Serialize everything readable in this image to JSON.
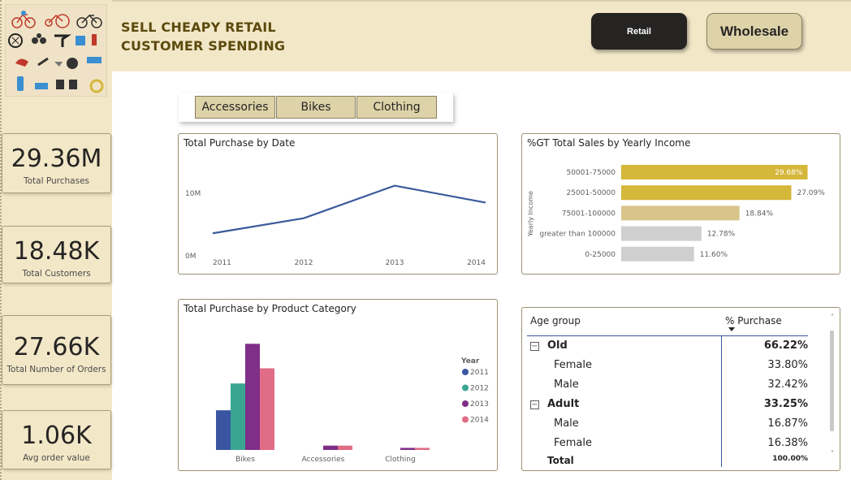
{
  "header": {
    "title_line1": "SELL CHEAPY RETAIL",
    "title_line2": "CUSTOMER SPENDING",
    "retail_button": "Retail",
    "wholesale_button": "Wholesale",
    "logo_icon": "bike-and-accessories-collage-icon"
  },
  "kpis": [
    {
      "value": "29.36M",
      "label": "Total Purchases"
    },
    {
      "value": "18.48K",
      "label": "Total Customers"
    },
    {
      "value": "27.66K",
      "label": "Total Number of Orders"
    },
    {
      "value": "1.06K",
      "label": "Avg order value"
    }
  ],
  "slicer": {
    "items": [
      "Accessories",
      "Bikes",
      "Clothing"
    ]
  },
  "colors": {
    "accent": "#f2e7c7",
    "line": "#3a5a9b",
    "gold": "#d5b73a",
    "tan": "#d9c58a",
    "grey": "#cfcfcf",
    "y2011": "#3a56a3",
    "y2012": "#3aa692",
    "y2013": "#7f2f88",
    "y2014": "#e06c86"
  },
  "chart_data": [
    {
      "type": "line",
      "title": "Total Purchase by Date",
      "x": [
        "2011",
        "2012",
        "2013",
        "2014"
      ],
      "values": [
        3600000,
        6000000,
        11200000,
        8500000
      ],
      "yticks": [
        {
          "label": "0M",
          "value": 0
        },
        {
          "label": "10M",
          "value": 10000000
        }
      ],
      "ylim": [
        0,
        14000000
      ]
    },
    {
      "type": "bar",
      "orientation": "horizontal",
      "title": "%GT Total Sales by Yearly Income",
      "ylabel": "Yearly Income",
      "categories": [
        "50001-75000",
        "25001-50000",
        "75001-100000",
        "greater than 100000",
        "0-25000"
      ],
      "values": [
        29.68,
        27.09,
        18.84,
        12.78,
        11.6
      ],
      "labels": [
        "29.68%",
        "27.09%",
        "18.84%",
        "12.78%",
        "11.60%"
      ],
      "xlim": [
        0,
        30
      ]
    },
    {
      "type": "bar",
      "title": "Total Purchase by Product Category",
      "categories": [
        "Bikes",
        "Accessories",
        "Clothing"
      ],
      "legend_title": "Year",
      "legend_position": "right",
      "series": [
        {
          "name": "2011",
          "values": [
            3400000,
            0,
            0
          ]
        },
        {
          "name": "2012",
          "values": [
            5700000,
            0,
            0
          ]
        },
        {
          "name": "2013",
          "values": [
            9100000,
            370000,
            180000
          ]
        },
        {
          "name": "2014",
          "values": [
            7000000,
            370000,
            180000
          ]
        }
      ],
      "ylim": [
        0,
        9400000
      ]
    }
  ],
  "matrix": {
    "col_group": "Age group",
    "col_value": "% Purchase",
    "rows": [
      {
        "label": "Old",
        "value": "66.22%",
        "level": 0
      },
      {
        "label": "Female",
        "value": "33.80%",
        "level": 1
      },
      {
        "label": "Male",
        "value": "32.42%",
        "level": 1
      },
      {
        "label": "Adult",
        "value": "33.25%",
        "level": 0
      },
      {
        "label": "Male",
        "value": "16.87%",
        "level": 1
      },
      {
        "label": "Female",
        "value": "16.38%",
        "level": 1
      }
    ],
    "total_label": "Total",
    "total_value": "100.00%",
    "expander_symbol": "−"
  }
}
